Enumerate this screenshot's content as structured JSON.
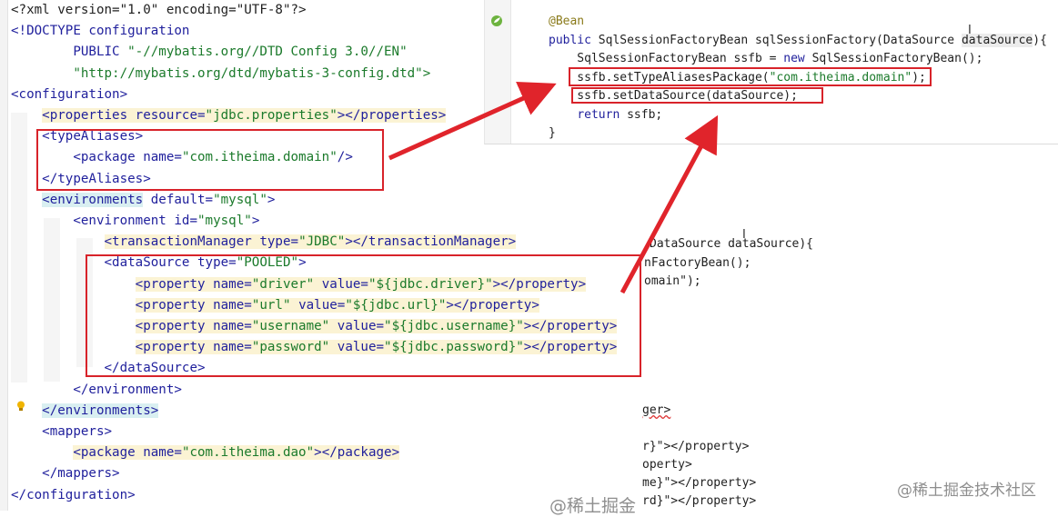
{
  "xml_editor": {
    "lines": [
      {
        "segments": [
          {
            "t": "<?xml version=\"1.0\" encoding=\"UTF-8\"?>",
            "c": "meta"
          }
        ]
      },
      {
        "segments": [
          {
            "t": "<!DOCTYPE configuration",
            "c": "tag"
          }
        ]
      },
      {
        "segments": [
          {
            "t": "        PUBLIC ",
            "c": "tag"
          },
          {
            "t": "\"-//mybatis.org//DTD Config 3.0//EN\"",
            "c": "dtd-str"
          }
        ]
      },
      {
        "segments": [
          {
            "t": "        \"http://mybatis.org/dtd/mybatis-3-config.dtd\">",
            "c": "dtd-str"
          }
        ]
      },
      {
        "segments": [
          {
            "t": "<configuration>",
            "c": "tag"
          }
        ]
      },
      {
        "segments": [
          {
            "t": "    ",
            "c": "meta"
          },
          {
            "t": "<properties ",
            "c": "tag",
            "h": "hl"
          },
          {
            "t": "resource=",
            "c": "attr",
            "h": "hl"
          },
          {
            "t": "\"jdbc.properties\"",
            "c": "str",
            "h": "hl"
          },
          {
            "t": "></properties>",
            "c": "tag",
            "h": "hl"
          }
        ]
      },
      {
        "segments": [
          {
            "t": "    ",
            "c": "meta"
          },
          {
            "t": "<typeAliases>",
            "c": "tag"
          }
        ]
      },
      {
        "segments": [
          {
            "t": "        ",
            "c": "meta"
          },
          {
            "t": "<package ",
            "c": "tag"
          },
          {
            "t": "name=",
            "c": "attr"
          },
          {
            "t": "\"com.itheima.domain\"",
            "c": "str"
          },
          {
            "t": "/>",
            "c": "tag"
          }
        ]
      },
      {
        "segments": [
          {
            "t": "    ",
            "c": "meta"
          },
          {
            "t": "</typeAliases>",
            "c": "tag"
          }
        ]
      },
      {
        "segments": [
          {
            "t": "    ",
            "c": "meta"
          },
          {
            "t": "<environments",
            "c": "tag",
            "h": "hl-cyan"
          },
          {
            "t": " default=",
            "c": "attr"
          },
          {
            "t": "\"mysql\"",
            "c": "str"
          },
          {
            "t": ">",
            "c": "tag"
          }
        ]
      },
      {
        "segments": [
          {
            "t": "        ",
            "c": "meta"
          },
          {
            "t": "<environment ",
            "c": "tag"
          },
          {
            "t": "id=",
            "c": "attr"
          },
          {
            "t": "\"mysql\"",
            "c": "str"
          },
          {
            "t": ">",
            "c": "tag"
          }
        ]
      },
      {
        "segments": [
          {
            "t": "            ",
            "c": "meta"
          },
          {
            "t": "<transactionManager ",
            "c": "tag",
            "h": "hl"
          },
          {
            "t": "type=",
            "c": "attr",
            "h": "hl"
          },
          {
            "t": "\"JDBC\"",
            "c": "str",
            "h": "hl"
          },
          {
            "t": "></transactionManager>",
            "c": "tag",
            "h": "hl"
          }
        ]
      },
      {
        "segments": [
          {
            "t": "            ",
            "c": "meta"
          },
          {
            "t": "<dataSource ",
            "c": "tag"
          },
          {
            "t": "type=",
            "c": "attr"
          },
          {
            "t": "\"POOLED\"",
            "c": "str"
          },
          {
            "t": ">",
            "c": "tag"
          }
        ]
      },
      {
        "segments": [
          {
            "t": "                ",
            "c": "meta"
          },
          {
            "t": "<property ",
            "c": "tag",
            "h": "hl"
          },
          {
            "t": "name=",
            "c": "attr",
            "h": "hl"
          },
          {
            "t": "\"driver\"",
            "c": "str",
            "h": "hl"
          },
          {
            "t": " value=",
            "c": "attr",
            "h": "hl"
          },
          {
            "t": "\"${jdbc.driver}\"",
            "c": "str",
            "h": "hl"
          },
          {
            "t": "></property>",
            "c": "tag",
            "h": "hl"
          }
        ]
      },
      {
        "segments": [
          {
            "t": "                ",
            "c": "meta"
          },
          {
            "t": "<property ",
            "c": "tag",
            "h": "hl"
          },
          {
            "t": "name=",
            "c": "attr",
            "h": "hl"
          },
          {
            "t": "\"url\"",
            "c": "str",
            "h": "hl"
          },
          {
            "t": " value=",
            "c": "attr",
            "h": "hl"
          },
          {
            "t": "\"${jdbc.url}\"",
            "c": "str",
            "h": "hl"
          },
          {
            "t": "></property>",
            "c": "tag",
            "h": "hl"
          }
        ]
      },
      {
        "segments": [
          {
            "t": "                ",
            "c": "meta"
          },
          {
            "t": "<property ",
            "c": "tag",
            "h": "hl"
          },
          {
            "t": "name=",
            "c": "attr",
            "h": "hl"
          },
          {
            "t": "\"username\"",
            "c": "str",
            "h": "hl"
          },
          {
            "t": " value=",
            "c": "attr",
            "h": "hl"
          },
          {
            "t": "\"${jdbc.username}\"",
            "c": "str",
            "h": "hl"
          },
          {
            "t": "></property>",
            "c": "tag",
            "h": "hl"
          }
        ]
      },
      {
        "segments": [
          {
            "t": "                ",
            "c": "meta"
          },
          {
            "t": "<property ",
            "c": "tag",
            "h": "hl"
          },
          {
            "t": "name=",
            "c": "attr",
            "h": "hl"
          },
          {
            "t": "\"password\"",
            "c": "str",
            "h": "hl"
          },
          {
            "t": " value=",
            "c": "attr",
            "h": "hl"
          },
          {
            "t": "\"${jdbc.password}\"",
            "c": "str",
            "h": "hl"
          },
          {
            "t": "></property>",
            "c": "tag",
            "h": "hl"
          }
        ]
      },
      {
        "segments": [
          {
            "t": "            ",
            "c": "meta"
          },
          {
            "t": "</dataSource>",
            "c": "tag"
          }
        ]
      },
      {
        "segments": [
          {
            "t": "        ",
            "c": "meta"
          },
          {
            "t": "</environment>",
            "c": "tag"
          }
        ]
      },
      {
        "segments": [
          {
            "t": "    ",
            "c": "meta"
          },
          {
            "t": "</environments>",
            "c": "tag",
            "h": "hl-cyan"
          }
        ]
      },
      {
        "segments": [
          {
            "t": "    ",
            "c": "meta"
          },
          {
            "t": "<mappers>",
            "c": "tag"
          }
        ]
      },
      {
        "segments": [
          {
            "t": "        ",
            "c": "meta"
          },
          {
            "t": "<package ",
            "c": "tag",
            "h": "hl"
          },
          {
            "t": "name=",
            "c": "attr",
            "h": "hl"
          },
          {
            "t": "\"com.itheima.dao\"",
            "c": "str",
            "h": "hl"
          },
          {
            "t": "></package>",
            "c": "tag",
            "h": "hl"
          }
        ]
      },
      {
        "segments": [
          {
            "t": "    ",
            "c": "meta"
          },
          {
            "t": "</mappers>",
            "c": "tag"
          }
        ]
      },
      {
        "segments": [
          {
            "t": "</configuration>",
            "c": "tag"
          }
        ]
      }
    ]
  },
  "java_editor": {
    "lines": [
      {
        "segments": [
          {
            "t": "@Bean",
            "c": "anno"
          }
        ]
      },
      {
        "segments": [
          {
            "t": "public ",
            "c": "kw"
          },
          {
            "t": "SqlSessionFactoryBean sqlSessionFactory(DataSource ",
            "c": "plain"
          },
          {
            "t": "dataSource",
            "c": "param"
          },
          {
            "t": "){",
            "c": "plain"
          }
        ]
      },
      {
        "segments": [
          {
            "t": "    SqlSessionFactoryBean ssfb = ",
            "c": "plain"
          },
          {
            "t": "new ",
            "c": "kw"
          },
          {
            "t": "SqlSessionFactoryBean();",
            "c": "plain"
          }
        ]
      },
      {
        "segments": [
          {
            "t": "    ssfb.setTypeAliasesPackage(",
            "c": "plain"
          },
          {
            "t": "\"com.itheima.domain\"",
            "c": "jstr"
          },
          {
            "t": ");",
            "c": "plain"
          }
        ]
      },
      {
        "segments": [
          {
            "t": "    ssfb.setDataSource(dataSource);",
            "c": "plain"
          }
        ]
      },
      {
        "segments": [
          {
            "t": "    ",
            "c": "plain"
          },
          {
            "t": "return ",
            "c": "kw"
          },
          {
            "t": "ssfb;",
            "c": "plain"
          }
        ]
      },
      {
        "segments": [
          {
            "t": "}",
            "c": "plain"
          }
        ]
      }
    ]
  },
  "background_code": {
    "lines": [
      {
        "t": "DataSource dataSource){"
      },
      {
        "t": "nFactoryBean();"
      },
      {
        "t": "omain\");"
      },
      {
        "t": "ger>"
      },
      {
        "t": "r}\"></property>"
      },
      {
        "t": "operty>"
      },
      {
        "t": "me}\"></property>"
      },
      {
        "t": "rd}\"></property>"
      }
    ]
  },
  "watermarks": {
    "right": "@稀土掘金技术社区",
    "bottom": "@稀土掘金"
  },
  "colors": {
    "annotation_box": "#d8232a",
    "arrow": "#e0242b"
  }
}
